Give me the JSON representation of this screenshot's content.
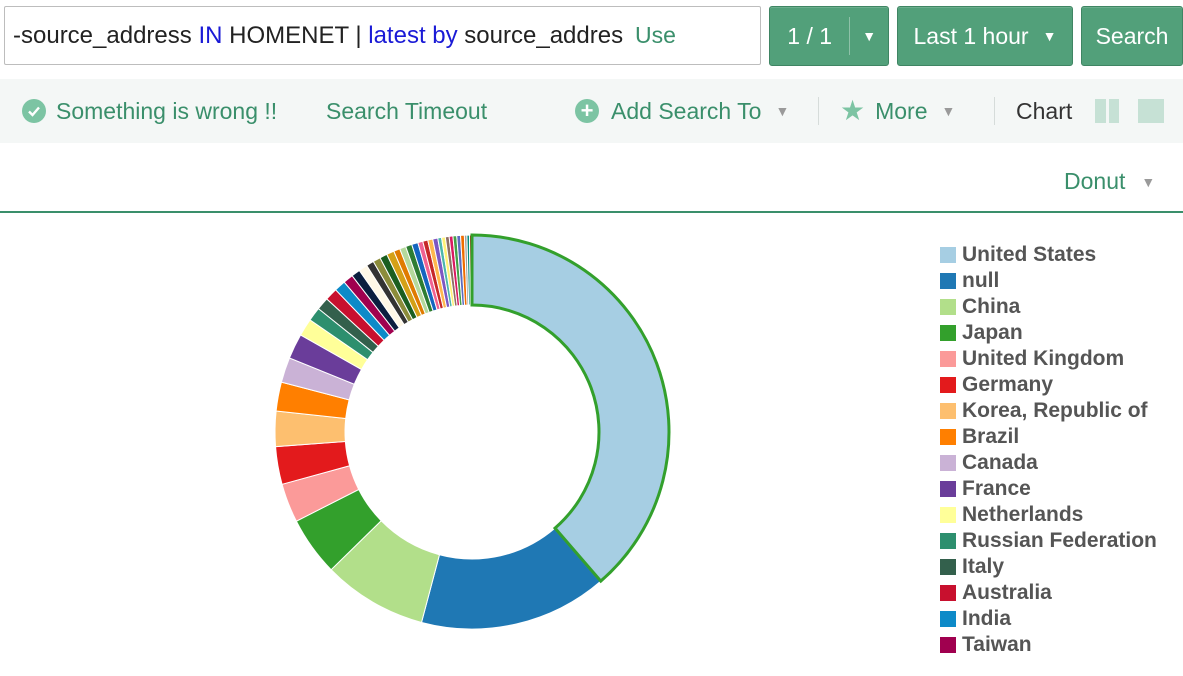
{
  "query": {
    "part1": "-source_address ",
    "kw1": "IN",
    "part2": " HOMENET | ",
    "kw2": "latest by",
    "part3": " source_address",
    "use_label": "Use"
  },
  "buttons": {
    "pages": "1 / 1",
    "time_range": "Last 1 hour",
    "search": "Search"
  },
  "toolbar": {
    "status": "Something is wrong !!",
    "timeout": "Search Timeout",
    "add_search_to": "Add Search To",
    "more": "More",
    "chart": "Chart"
  },
  "chart_type": "Donut",
  "chart_data": {
    "type": "pie",
    "variant": "donut",
    "legend_position": "right",
    "highlighted": "United States",
    "legend": [
      {
        "label": "United States",
        "color": "#a6cee3"
      },
      {
        "label": "null",
        "color": "#1f78b4"
      },
      {
        "label": "China",
        "color": "#b2df8a"
      },
      {
        "label": "Japan",
        "color": "#33a02c"
      },
      {
        "label": "United Kingdom",
        "color": "#fb9a99"
      },
      {
        "label": "Germany",
        "color": "#e31a1c"
      },
      {
        "label": "Korea, Republic of",
        "color": "#fdbf6f"
      },
      {
        "label": "Brazil",
        "color": "#ff7f00"
      },
      {
        "label": "Canada",
        "color": "#cab2d6"
      },
      {
        "label": "France",
        "color": "#6a3d9a"
      },
      {
        "label": "Netherlands",
        "color": "#ffff99"
      },
      {
        "label": "Russian Federation",
        "color": "#2d8f6e"
      },
      {
        "label": "Italy",
        "color": "#33604c"
      },
      {
        "label": "Australia",
        "color": "#c8102e"
      },
      {
        "label": "India",
        "color": "#0d8ac8"
      },
      {
        "label": "Taiwan",
        "color": "#a0004f"
      }
    ],
    "slices": [
      {
        "label": "United States",
        "value": 37.5,
        "color": "#a6cee3"
      },
      {
        "label": "null",
        "value": 15.0,
        "color": "#1f78b4"
      },
      {
        "label": "China",
        "value": 8.3,
        "color": "#b2df8a"
      },
      {
        "label": "Japan",
        "value": 4.7,
        "color": "#33a02c"
      },
      {
        "label": "United Kingdom",
        "value": 3.1,
        "color": "#fb9a99"
      },
      {
        "label": "Germany",
        "value": 3.0,
        "color": "#e31a1c"
      },
      {
        "label": "Korea, Republic of",
        "value": 2.8,
        "color": "#fdbf6f"
      },
      {
        "label": "Brazil",
        "value": 2.3,
        "color": "#ff7f00"
      },
      {
        "label": "Canada",
        "value": 2.0,
        "color": "#cab2d6"
      },
      {
        "label": "France",
        "value": 2.0,
        "color": "#6a3d9a"
      },
      {
        "label": "Netherlands",
        "value": 1.4,
        "color": "#ffff99"
      },
      {
        "label": "Russian Federation",
        "value": 1.1,
        "color": "#2d8f6e"
      },
      {
        "label": "Italy",
        "value": 1.0,
        "color": "#33604c"
      },
      {
        "label": "Australia",
        "value": 1.0,
        "color": "#c8102e"
      },
      {
        "label": "India",
        "value": 0.9,
        "color": "#0d8ac8"
      },
      {
        "label": "Taiwan",
        "value": 0.8,
        "color": "#a0004f"
      },
      {
        "value": 0.7,
        "color": "#0b1e3f"
      },
      {
        "value": 0.7,
        "color": "#fff8e7"
      },
      {
        "value": 0.6,
        "color": "#333333"
      },
      {
        "value": 0.6,
        "color": "#8c8c3a"
      },
      {
        "value": 0.6,
        "color": "#1b5e20"
      },
      {
        "value": 0.6,
        "color": "#d4a017"
      },
      {
        "value": 0.5,
        "color": "#e07b00"
      },
      {
        "value": 0.5,
        "color": "#b5d99c"
      },
      {
        "value": 0.5,
        "color": "#2e7d32"
      },
      {
        "value": 0.5,
        "color": "#1565c0"
      },
      {
        "value": 0.4,
        "color": "#f06292"
      },
      {
        "value": 0.4,
        "color": "#c62828"
      },
      {
        "value": 0.4,
        "color": "#ffb74d"
      },
      {
        "value": 0.4,
        "color": "#7e57c2"
      },
      {
        "value": 0.3,
        "color": "#4db6ac"
      },
      {
        "value": 0.3,
        "color": "#fff176"
      },
      {
        "value": 0.3,
        "color": "#8d6e63"
      },
      {
        "value": 0.3,
        "color": "#d81b60"
      },
      {
        "value": 0.3,
        "color": "#43a047"
      },
      {
        "value": 0.3,
        "color": "#5c6bc0"
      },
      {
        "value": 0.3,
        "color": "#ef6c00"
      },
      {
        "value": 0.2,
        "color": "#9e9e9e"
      },
      {
        "value": 0.2,
        "color": "#00897b"
      },
      {
        "value": 0.2,
        "color": "#b71c1c"
      }
    ]
  }
}
